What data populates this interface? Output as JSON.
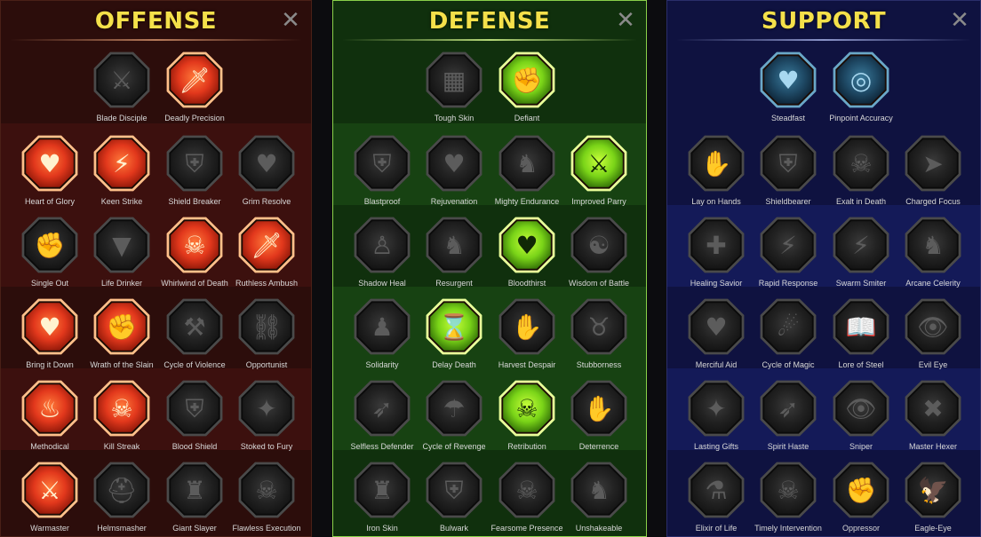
{
  "colors": {
    "title": "#f4e04a",
    "offense_active": "#e0482a",
    "defense_active": "#8adc2a",
    "support_active": "#2a6a8a",
    "inactive": "#2a2a2a"
  },
  "panels": [
    {
      "id": "offense",
      "title": "OFFENSE",
      "close_label": "✕",
      "rows": [
        [
          {
            "label": "Blade Disciple",
            "icon": "crossed-swords-icon",
            "active": false,
            "glyph": "⚔"
          },
          {
            "label": "Deadly Precision",
            "icon": "piercing-blade-icon",
            "active": true,
            "glyph": "🗡"
          }
        ],
        [
          {
            "label": "Heart of Glory",
            "icon": "horned-heart-icon",
            "active": true,
            "glyph": "♥"
          },
          {
            "label": "Keen Strike",
            "icon": "keen-strike-icon",
            "active": true,
            "glyph": "⚡"
          },
          {
            "label": "Shield Breaker",
            "icon": "shield-breaker-icon",
            "active": false,
            "glyph": "⛨"
          },
          {
            "label": "Grim Resolve",
            "icon": "grim-heart-icon",
            "active": false,
            "glyph": "♥"
          }
        ],
        [
          {
            "label": "Single Out",
            "icon": "single-out-icon",
            "active": false,
            "glyph": "✊"
          },
          {
            "label": "Life Drinker",
            "icon": "fangs-icon",
            "active": false,
            "glyph": "▼"
          },
          {
            "label": "Whirlwind of Death",
            "icon": "whirlwind-skull-icon",
            "active": true,
            "glyph": "☠"
          },
          {
            "label": "Ruthless Ambush",
            "icon": "dagger-hand-icon",
            "active": true,
            "glyph": "🗡"
          }
        ],
        [
          {
            "label": "Bring it Down",
            "icon": "bring-it-down-icon",
            "active": true,
            "glyph": "♥"
          },
          {
            "label": "Wrath of the Slain",
            "icon": "fist-sword-icon",
            "active": true,
            "glyph": "✊"
          },
          {
            "label": "Cycle of Violence",
            "icon": "axe-icon",
            "active": false,
            "glyph": "⚒"
          },
          {
            "label": "Opportunist",
            "icon": "chains-icon",
            "active": false,
            "glyph": "⛓"
          }
        ],
        [
          {
            "label": "Methodical",
            "icon": "methodical-icon",
            "active": true,
            "glyph": "♨"
          },
          {
            "label": "Kill Streak",
            "icon": "skulls-icon",
            "active": true,
            "glyph": "☠"
          },
          {
            "label": "Blood Shield",
            "icon": "blood-shield-icon",
            "active": false,
            "glyph": "⛨"
          },
          {
            "label": "Stoked to Fury",
            "icon": "fury-icon",
            "active": false,
            "glyph": "✦"
          }
        ],
        [
          {
            "label": "Warmaster",
            "icon": "warmaster-icon",
            "active": true,
            "glyph": "⚔"
          },
          {
            "label": "Helmsmasher",
            "icon": "helmet-icon",
            "active": false,
            "glyph": "⛑"
          },
          {
            "label": "Giant Slayer",
            "icon": "giant-icon",
            "active": false,
            "glyph": "♜"
          },
          {
            "label": "Flawless Execution",
            "icon": "skull-sword-icon",
            "active": false,
            "glyph": "☠"
          }
        ]
      ]
    },
    {
      "id": "defense",
      "title": "DEFENSE",
      "close_label": "✕",
      "rows": [
        [
          {
            "label": "Tough Skin",
            "icon": "scales-icon",
            "active": false,
            "glyph": "▦"
          },
          {
            "label": "Defiant",
            "icon": "raised-fist-icon",
            "active": true,
            "glyph": "✊"
          }
        ],
        [
          {
            "label": "Blastproof",
            "icon": "chevron-shield-icon",
            "active": false,
            "glyph": "⛨"
          },
          {
            "label": "Rejuvenation",
            "icon": "anatomical-heart-icon",
            "active": false,
            "glyph": "♥"
          },
          {
            "label": "Mighty Endurance",
            "icon": "muscle-icon",
            "active": false,
            "glyph": "♞"
          },
          {
            "label": "Improved Parry",
            "icon": "crossed-blades-icon",
            "active": true,
            "glyph": "⚔"
          }
        ],
        [
          {
            "label": "Shadow Heal",
            "icon": "shadow-heal-icon",
            "active": false,
            "glyph": "♙"
          },
          {
            "label": "Resurgent",
            "icon": "armored-knight-icon",
            "active": false,
            "glyph": "♞"
          },
          {
            "label": "Bloodthirst",
            "icon": "skull-heart-icon",
            "active": true,
            "glyph": "♥"
          },
          {
            "label": "Wisdom of Battle",
            "icon": "meditation-icon",
            "active": false,
            "glyph": "☯"
          }
        ],
        [
          {
            "label": "Solidarity",
            "icon": "group-icon",
            "active": false,
            "glyph": "♟"
          },
          {
            "label": "Delay Death",
            "icon": "hourglass-skull-icon",
            "active": true,
            "glyph": "⌛"
          },
          {
            "label": "Harvest Despair",
            "icon": "open-hand-icon",
            "active": false,
            "glyph": "✋"
          },
          {
            "label": "Stubborness",
            "icon": "bull-icon",
            "active": false,
            "glyph": "♉"
          }
        ],
        [
          {
            "label": "Selfless Defender",
            "icon": "running-defender-icon",
            "active": false,
            "glyph": "➶"
          },
          {
            "label": "Cycle of Revenge",
            "icon": "drops-icon",
            "active": false,
            "glyph": "☂"
          },
          {
            "label": "Retribution",
            "icon": "radiant-skull-icon",
            "active": true,
            "glyph": "☠"
          },
          {
            "label": "Deterrence",
            "icon": "deterrence-icon",
            "active": false,
            "glyph": "✋"
          }
        ],
        [
          {
            "label": "Iron Skin",
            "icon": "iron-skin-icon",
            "active": false,
            "glyph": "♜"
          },
          {
            "label": "Bulwark",
            "icon": "bulwark-icon",
            "active": false,
            "glyph": "⛨"
          },
          {
            "label": "Fearsome Presence",
            "icon": "hooded-skull-icon",
            "active": false,
            "glyph": "☠"
          },
          {
            "label": "Unshakeable",
            "icon": "strongman-icon",
            "active": false,
            "glyph": "♞"
          }
        ]
      ]
    },
    {
      "id": "support",
      "title": "SUPPORT",
      "close_label": "✕",
      "rows": [
        [
          {
            "label": "Steadfast",
            "icon": "heart-plus-icon",
            "active": true,
            "glyph": "♥"
          },
          {
            "label": "Pinpoint Accuracy",
            "icon": "target-icon",
            "active": true,
            "glyph": "◎"
          }
        ],
        [
          {
            "label": "Lay on Hands",
            "icon": "praying-hands-icon",
            "active": false,
            "glyph": "✋"
          },
          {
            "label": "Shieldbearer",
            "icon": "shield-icon",
            "active": false,
            "glyph": "⛨"
          },
          {
            "label": "Exalt in Death",
            "icon": "flaming-skull-icon",
            "active": false,
            "glyph": "☠"
          },
          {
            "label": "Charged Focus",
            "icon": "charged-focus-icon",
            "active": false,
            "glyph": "➤"
          }
        ],
        [
          {
            "label": "Healing Savior",
            "icon": "healing-savior-icon",
            "active": false,
            "glyph": "✚"
          },
          {
            "label": "Rapid Response",
            "icon": "lightning-icon",
            "active": false,
            "glyph": "⚡"
          },
          {
            "label": "Swarm Smiter",
            "icon": "claw-marks-icon",
            "active": false,
            "glyph": "⚡"
          },
          {
            "label": "Arcane Celerity",
            "icon": "arcane-celerity-icon",
            "active": false,
            "glyph": "♞"
          }
        ],
        [
          {
            "label": "Merciful Aid",
            "icon": "chained-heart-icon",
            "active": false,
            "glyph": "♥"
          },
          {
            "label": "Cycle of Magic",
            "icon": "comet-icon",
            "active": false,
            "glyph": "☄"
          },
          {
            "label": "Lore of Steel",
            "icon": "book-icon",
            "active": false,
            "glyph": "📖"
          },
          {
            "label": "Evil Eye",
            "icon": "evil-eye-icon",
            "active": false,
            "glyph": "👁"
          }
        ],
        [
          {
            "label": "Lasting Gifts",
            "icon": "star-icon",
            "active": false,
            "glyph": "✦"
          },
          {
            "label": "Spirit Haste",
            "icon": "boot-icon",
            "active": false,
            "glyph": "➶"
          },
          {
            "label": "Sniper",
            "icon": "eye-icon",
            "active": false,
            "glyph": "👁"
          },
          {
            "label": "Master Hexer",
            "icon": "hexer-icon",
            "active": false,
            "glyph": "✖"
          }
        ],
        [
          {
            "label": "Elixir of Life",
            "icon": "potion-icon",
            "active": false,
            "glyph": "⚗"
          },
          {
            "label": "Timely Intervention",
            "icon": "skull-icon",
            "active": false,
            "glyph": "☠"
          },
          {
            "label": "Oppressor",
            "icon": "oppressor-icon",
            "active": false,
            "glyph": "✊"
          },
          {
            "label": "Eagle-Eye",
            "icon": "eagle-icon",
            "active": false,
            "glyph": "🦅"
          }
        ]
      ]
    }
  ]
}
